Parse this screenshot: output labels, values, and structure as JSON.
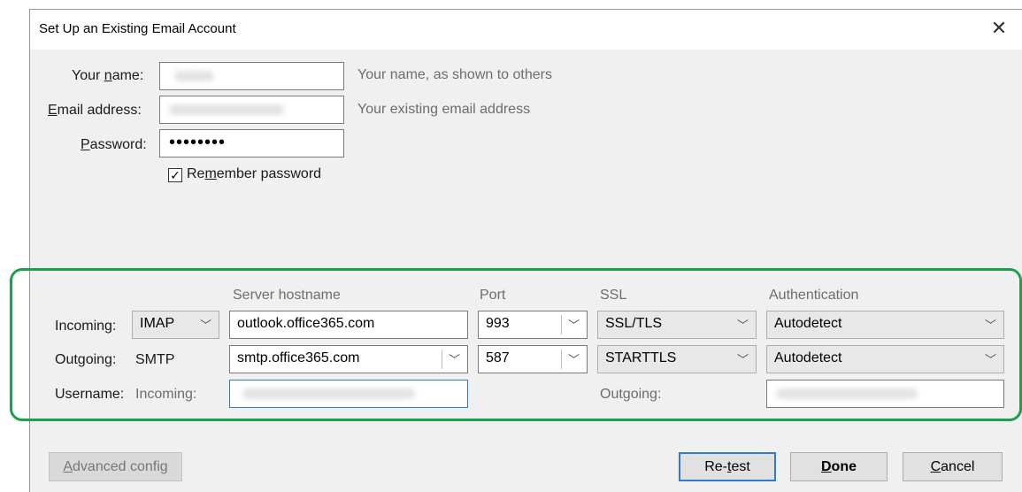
{
  "dialog": {
    "title": "Set Up an Existing Email Account",
    "close_glyph": "✕"
  },
  "identity": {
    "name_label_pre": "Your ",
    "name_label_u": "n",
    "name_label_post": "ame:",
    "name_hint": "Your name, as shown to others",
    "email_label_u": "E",
    "email_label_post": "mail address:",
    "email_hint": "Your existing email address",
    "password_label_u": "P",
    "password_label_post": "assword:",
    "password_value": "••••••••",
    "remember_pre": "Re",
    "remember_u": "m",
    "remember_post": "ember password",
    "remember_checked": true
  },
  "server": {
    "headers": {
      "hostname": "Server hostname",
      "port": "Port",
      "ssl": "SSL",
      "auth": "Authentication"
    },
    "incoming": {
      "label": "Incoming:",
      "protocol": "IMAP",
      "hostname": "outlook.office365.com",
      "port": "993",
      "ssl": "SSL/TLS",
      "auth": "Autodetect"
    },
    "outgoing": {
      "label": "Outgoing:",
      "protocol": "SMTP",
      "hostname": "smtp.office365.com",
      "port": "587",
      "ssl": "STARTTLS",
      "auth": "Autodetect"
    },
    "username": {
      "label": "Username:",
      "incoming_label": "Incoming:",
      "outgoing_label": "Outgoing:"
    }
  },
  "buttons": {
    "advanced_u": "A",
    "advanced_post": "dvanced config",
    "retest_pre": "Re-",
    "retest_u": "t",
    "retest_post": "est",
    "done_u": "D",
    "done_post": "one",
    "cancel_pre": "",
    "cancel_u": "C",
    "cancel_post": "ancel"
  },
  "colors": {
    "highlight": "#18a34a",
    "focus": "#2f7bd3"
  },
  "icons": {
    "close": "close-icon",
    "chevron": "chevron-down-icon",
    "check": "checkmark-icon"
  }
}
